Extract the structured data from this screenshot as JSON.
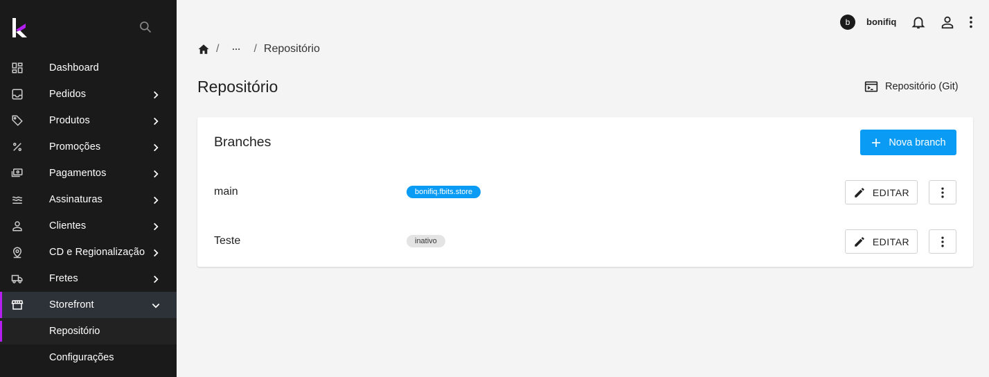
{
  "sidebar": {
    "logo": "k-logo",
    "search_icon": "search-icon",
    "items": [
      {
        "label": "Dashboard",
        "icon": "dashboard-icon"
      },
      {
        "label": "Pedidos",
        "icon": "inbox-icon"
      },
      {
        "label": "Produtos",
        "icon": "tag-icon"
      },
      {
        "label": "Promoções",
        "icon": "percent-icon"
      },
      {
        "label": "Pagamentos",
        "icon": "payments-icon"
      },
      {
        "label": "Assinaturas",
        "icon": "subscriptions-icon"
      },
      {
        "label": "Clientes",
        "icon": "person-icon"
      },
      {
        "label": "CD e Regionalização",
        "icon": "location-pin-icon"
      },
      {
        "label": "Fretes",
        "icon": "truck-icon"
      },
      {
        "label": "Storefront",
        "icon": "storefront-icon"
      }
    ],
    "sub_items": [
      {
        "label": "Repositório"
      },
      {
        "label": "Configurações"
      }
    ],
    "accent_color": "#b31ff0"
  },
  "topbar": {
    "avatar_initial": "b",
    "username": "bonifiq"
  },
  "breadcrumb": {
    "separator": "/",
    "current": "Repositório"
  },
  "page": {
    "title": "Repositório",
    "git_button_label": "Repositório (Git)"
  },
  "card": {
    "title": "Branches",
    "new_button_label": "Nova branch",
    "button_color": "#0a9bf5",
    "branches": [
      {
        "name": "main",
        "badge": "bonifiq.fbits.store",
        "badge_style": "blue",
        "edit_label": "EDITAR"
      },
      {
        "name": "Teste",
        "badge": "inativo",
        "badge_style": "grey",
        "edit_label": "EDITAR"
      }
    ]
  }
}
